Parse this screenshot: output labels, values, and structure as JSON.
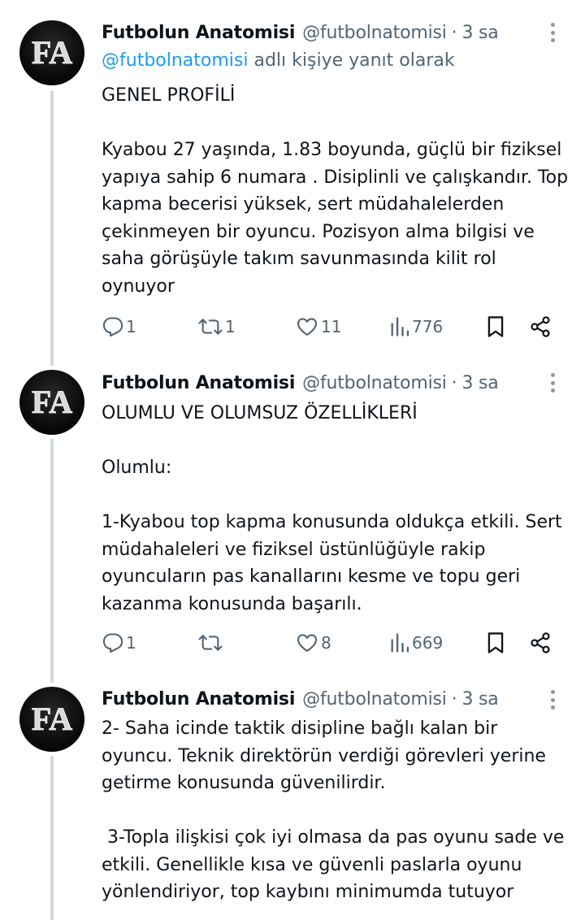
{
  "tweets": [
    {
      "author": {
        "name": "Futbolun Anatomisi",
        "handle": "@futbolnatomisi",
        "time": "3 sa",
        "avatar_text": "FA"
      },
      "reply_to": {
        "mention": "@futbolnatomisi",
        "suffix": " adlı kişiye yanıt olarak"
      },
      "text": "GENEL PROFİLİ\n\nKyabou 27 yaşında, 1.83 boyunda, güçlü bir fiziksel yapıya sahip 6 numara . Disiplinli ve çalışkandır. Top kapma becerisi yüksek, sert müdahalelerden çekinmeyen bir oyuncu. Pozisyon alma bilgisi ve saha görüşüyle takım savunmasında kilit rol oynuyor",
      "stats": {
        "replies": "1",
        "reposts": "1",
        "likes": "11",
        "views": "776"
      }
    },
    {
      "author": {
        "name": "Futbolun Anatomisi",
        "handle": "@futbolnatomisi",
        "time": "3 sa",
        "avatar_text": "FA"
      },
      "text": "OLUMLU VE OLUMSUZ ÖZELLİKLERİ\n\nOlumlu:\n\n1-Kyabou top kapma konusunda oldukça etkili. Sert müdahaleleri ve fiziksel üstünlüğüyle rakip oyuncuların pas kanallarını kesme ve topu geri kazanma konusunda başarılı.",
      "stats": {
        "replies": "1",
        "reposts": "",
        "likes": "8",
        "views": "669"
      }
    },
    {
      "author": {
        "name": "Futbolun Anatomisi",
        "handle": "@futbolnatomisi",
        "time": "3 sa",
        "avatar_text": "FA"
      },
      "text": "2- Saha icinde taktik disipline bağlı kalan bir oyuncu. Teknik direktörün verdiği görevleri yerine getirme konusunda güvenilirdir.\n\n 3-Topla ilişkisi çok iyi olmasa da pas oyunu sade ve etkili. Genellikle kısa ve güvenli paslarla oyunu yönlendiriyor, top kaybını minimumda tutuyor"
    }
  ],
  "colors": {
    "text": "#0f1419",
    "secondary": "#536471",
    "link": "#1d9bf0",
    "thread": "#cfd9de"
  },
  "icons": [
    "reply-icon",
    "repost-icon",
    "like-icon",
    "views-icon",
    "bookmark-icon",
    "share-icon",
    "more-icon"
  ]
}
